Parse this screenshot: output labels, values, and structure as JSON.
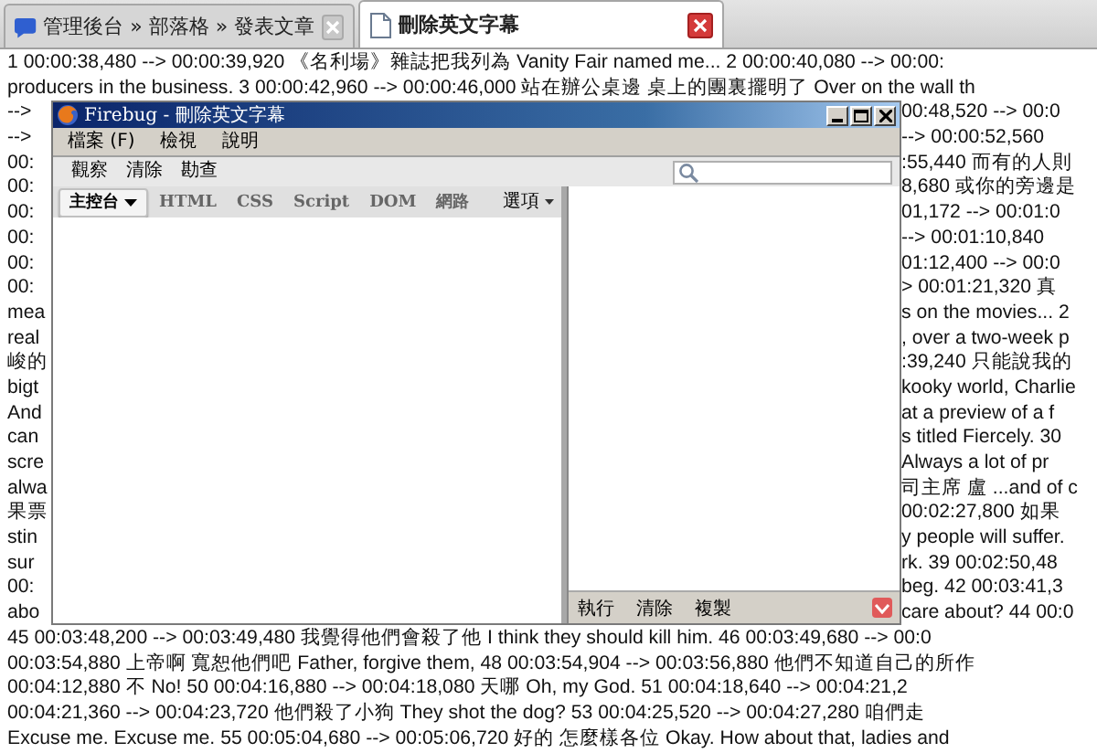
{
  "browser_tabs": [
    {
      "title": "管理後台 » 部落格 » 發表文章",
      "selected": false
    },
    {
      "title": "刪除英文字幕",
      "selected": true
    }
  ],
  "page_lines": [
    {
      "kind": "full",
      "text": "1 00:00:38,480 --> 00:00:39,920 《名利場》雜誌把我列為 Vanity Fair named me... 2 00:00:40,080 --> 00:00:"
    },
    {
      "kind": "full",
      "text": "producers in the business. 3 00:00:42,960 --> 00:00:46,000 站在辦公桌邊 桌上的團裏擺明了 Over on the wall th"
    },
    {
      "kind": "split",
      "left": "-->",
      "right": "00:48,520 --> 00:0"
    },
    {
      "kind": "split",
      "left": "-->",
      "right": "--> 00:00:52,560"
    },
    {
      "kind": "split",
      "left": "00:",
      "right": ":55,440 而有的人則"
    },
    {
      "kind": "split",
      "left": "00:",
      "right": "8,680 或你的旁邊是"
    },
    {
      "kind": "split",
      "left": "00:",
      "right": "01,172 --> 00:01:0"
    },
    {
      "kind": "split",
      "left": "00:",
      "right": "--> 00:01:10,840"
    },
    {
      "kind": "split",
      "left": "00:",
      "right": "01:12,400 --> 00:0"
    },
    {
      "kind": "split",
      "left": "00:",
      "right": "> 00:01:21,320 真"
    },
    {
      "kind": "split",
      "left": "mea",
      "right": "s on the movies... 2"
    },
    {
      "kind": "split",
      "left": "real",
      "right": ", over a two-week p"
    },
    {
      "kind": "split",
      "left": "峻的",
      "right": ":39,240 只能說我的"
    },
    {
      "kind": "split",
      "left": "bigt",
      "right": "kooky world, Charlie"
    },
    {
      "kind": "split",
      "left": "And",
      "right": "at a preview of a f"
    },
    {
      "kind": "split",
      "left": "can",
      "right": "s titled Fiercely. 30"
    },
    {
      "kind": "split",
      "left": "scre",
      "right": "Always a lot of pr"
    },
    {
      "kind": "split",
      "left": "alwa",
      "right": "司主席 盧 ...and of c"
    },
    {
      "kind": "split",
      "left": "果票",
      "right": "00:02:27,800 如果"
    },
    {
      "kind": "split",
      "left": "stin",
      "right": "y people will suffer."
    },
    {
      "kind": "split",
      "left": "sur",
      "right": "rk. 39 00:02:50,48"
    },
    {
      "kind": "split",
      "left": "00:",
      "right": "beg. 42 00:03:41,3"
    },
    {
      "kind": "split",
      "left": "abo",
      "right": "care about? 44 00:0"
    },
    {
      "kind": "full",
      "text": "45 00:03:48,200 --> 00:03:49,480 我覺得他們會殺了他 I think they should kill him. 46 00:03:49,680 --> 00:0"
    },
    {
      "kind": "full",
      "text": "00:03:54,880 上帝啊 寬恕他們吧 Father, forgive them, 48 00:03:54,904 --> 00:03:56,880 他們不知道自己的所作"
    },
    {
      "kind": "full",
      "text": "00:04:12,880 不 No! 50 00:04:16,880 --> 00:04:18,080 天哪 Oh, my God. 51 00:04:18,640 --> 00:04:21,2"
    },
    {
      "kind": "full",
      "text": "00:04:21,360 --> 00:04:23,720 他們殺了小狗 They shot the dog? 53 00:04:25,520 --> 00:04:27,280 咱們走"
    },
    {
      "kind": "full",
      "text": "Excuse me. Excuse me. 55 00:05:04,680 --> 00:05:06,720 好的 怎麼樣各位 Okay. How about that, ladies and"
    }
  ],
  "firebug": {
    "title": "Firebug - 刪除英文字幕",
    "menu": [
      "檔案 (F)",
      "檢視",
      "說明"
    ],
    "toolbar": [
      "觀察",
      "清除",
      "勘查"
    ],
    "tabs": [
      {
        "label": "主控台",
        "dropdown": true,
        "selected": true
      },
      {
        "label": "HTML",
        "dropdown": false,
        "selected": false
      },
      {
        "label": "CSS",
        "dropdown": false,
        "selected": false
      },
      {
        "label": "Script",
        "dropdown": false,
        "selected": false
      },
      {
        "label": "DOM",
        "dropdown": false,
        "selected": false
      },
      {
        "label": "網路",
        "dropdown": false,
        "selected": false
      }
    ],
    "options": "選項",
    "command_buttons": [
      "執行",
      "清除",
      "複製"
    ]
  }
}
